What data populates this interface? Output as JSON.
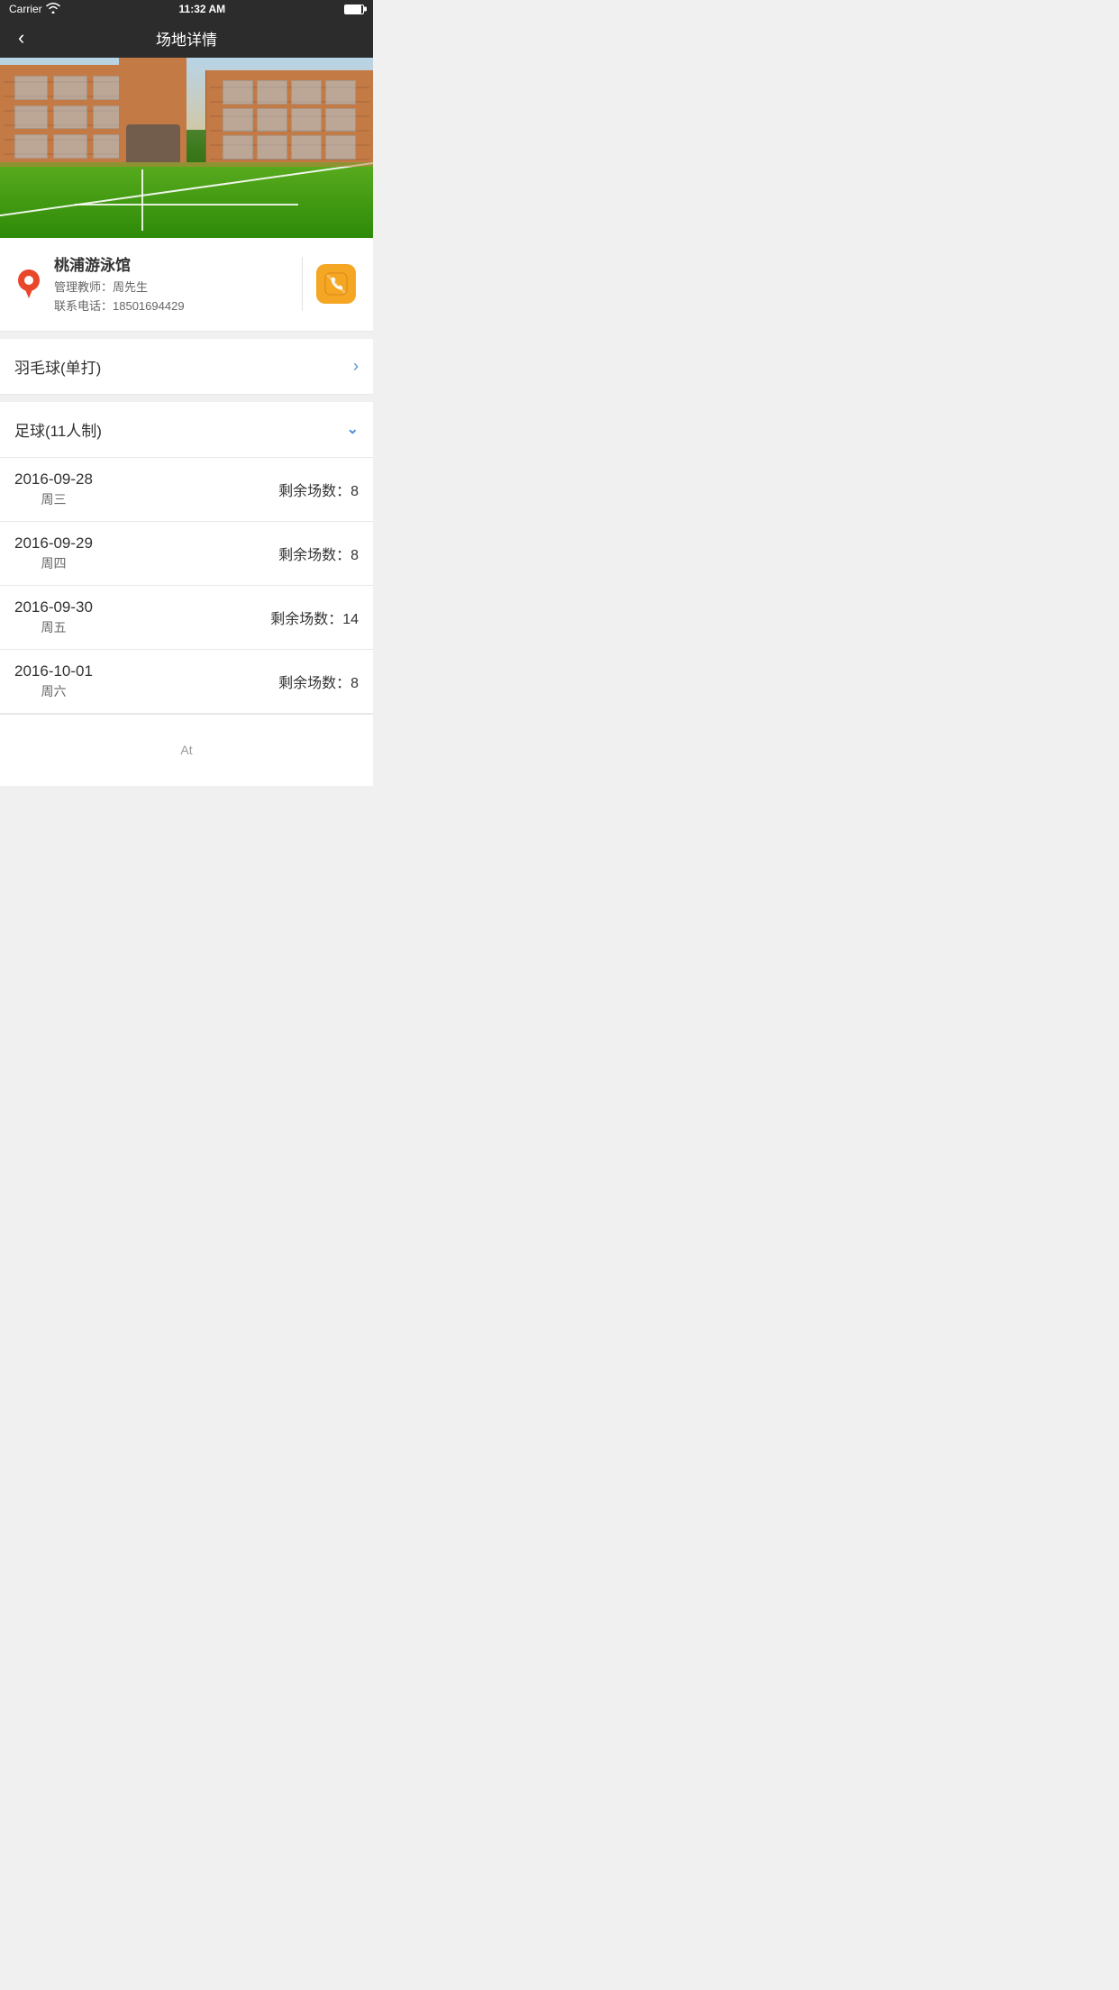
{
  "statusBar": {
    "carrier": "Carrier",
    "time": "11:32 AM"
  },
  "navBar": {
    "back": "<",
    "title": "场地详情"
  },
  "venue": {
    "name": "桃浦游泳馆",
    "managerLabel": "管理教师：",
    "manager": "周先生",
    "phoneLabel": "联系电话：",
    "phone": "18501694429"
  },
  "sports": [
    {
      "name": "羽毛球(单打)",
      "expanded": false
    },
    {
      "name": "足球(11人制)",
      "expanded": true
    }
  ],
  "dates": [
    {
      "date": "2016-09-28",
      "day": "周三",
      "remainLabel": "剩余场数：",
      "remain": "8"
    },
    {
      "date": "2016-09-29",
      "day": "周四",
      "remainLabel": "剩余场数：",
      "remain": "8"
    },
    {
      "date": "2016-09-30",
      "day": "周五",
      "remainLabel": "剩余场数：",
      "remain": "14"
    },
    {
      "date": "2016-10-01",
      "day": "周六",
      "remainLabel": "剩余场数：",
      "remain": "8"
    }
  ],
  "bottomHint": "At"
}
